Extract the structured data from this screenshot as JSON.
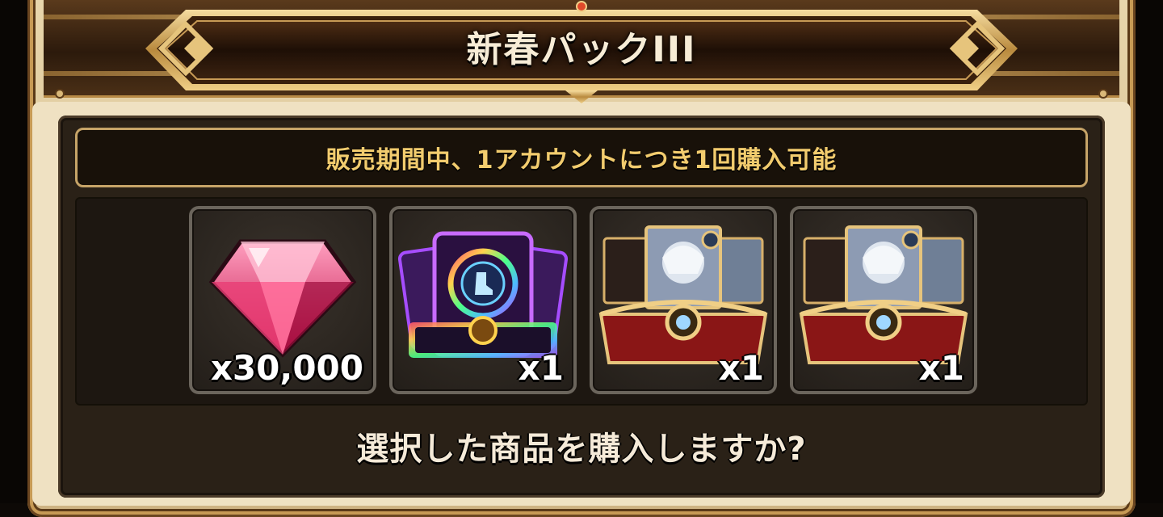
{
  "dialog": {
    "title": "新春パックIII",
    "notice": "販売期間中、1アカウントにつき1回購入可能",
    "question": "選択した商品を購入しますか?"
  },
  "items": [
    {
      "icon": "pink-gem-icon",
      "quantity": "x30,000"
    },
    {
      "icon": "rainbow-boot-card-pack-icon",
      "quantity": "x1"
    },
    {
      "icon": "character-card-chest-icon",
      "quantity": "x1"
    },
    {
      "icon": "character-card-chest-icon",
      "quantity": "x1"
    }
  ],
  "colors": {
    "notice_text": "#f2cc6e",
    "gold_trim": "#c6a468",
    "panel_bg": "#2a2117"
  }
}
